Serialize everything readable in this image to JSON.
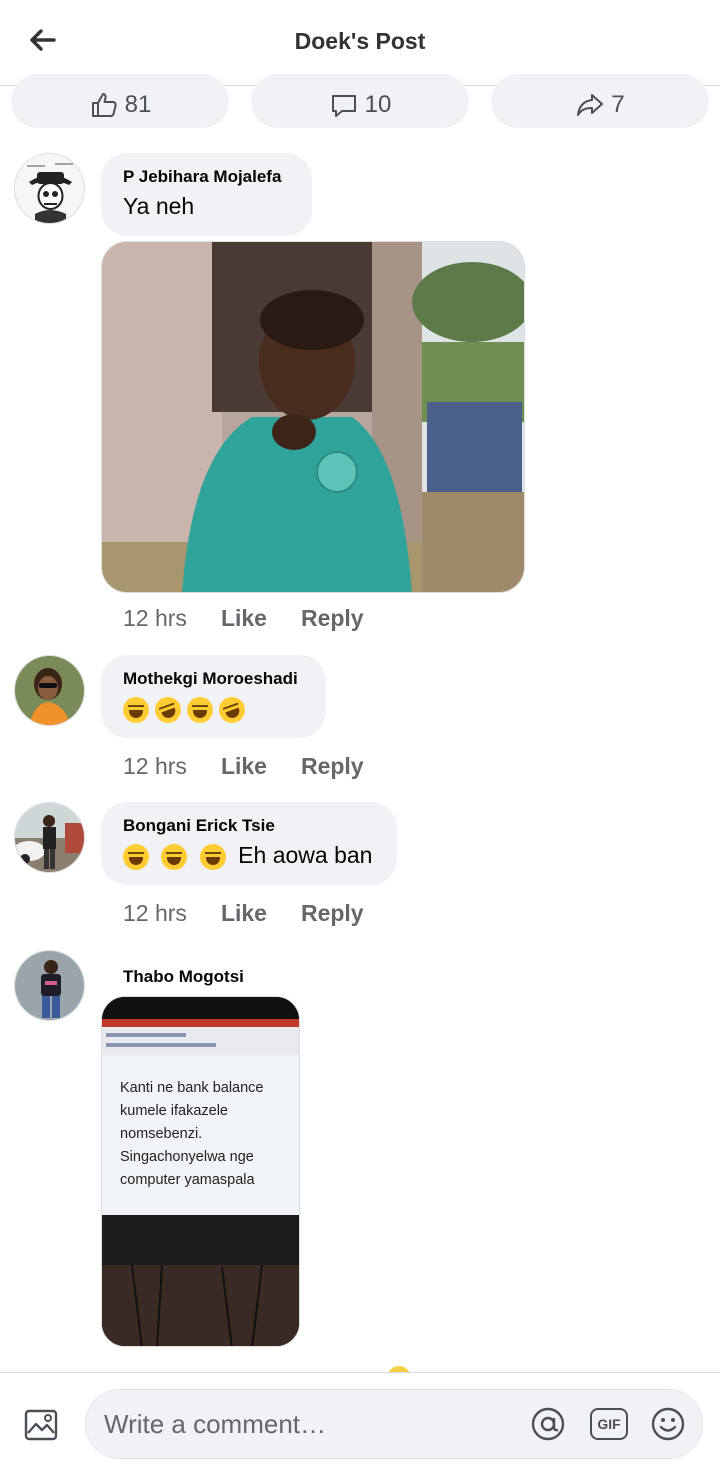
{
  "header": {
    "title": "Doek's Post"
  },
  "stats": {
    "likes": "81",
    "comments": "10",
    "shares": "7"
  },
  "comments": [
    {
      "author": "P Jebihara Mojalefa",
      "text": "Ya neh",
      "time": "12 hrs",
      "like": "Like",
      "reply": "Reply"
    },
    {
      "author": "Mothekgi Moroeshadi",
      "text": "",
      "time": "12 hrs",
      "like": "Like",
      "reply": "Reply"
    },
    {
      "author": "Bongani Erick Tsie",
      "text": "Eh aowa ban",
      "time": "12 hrs",
      "like": "Like",
      "reply": "Reply"
    },
    {
      "author": "Thabo Mogotsi",
      "image_text": [
        "Kanti ne bank balance",
        "kumele ifakazele",
        "nomsebenzi.",
        "Singachonyelwa nge",
        "computer yamaspala"
      ]
    }
  ],
  "composer": {
    "placeholder": "Write a comment…",
    "gif_label": "GIF"
  },
  "icons": {
    "back": "back-arrow-icon",
    "like": "thumbs-up-icon",
    "comment": "comment-bubble-icon",
    "share": "share-arrow-icon",
    "photo": "photo-icon",
    "mention": "at-icon",
    "gif": "gif-icon",
    "emoji": "smiley-icon"
  }
}
